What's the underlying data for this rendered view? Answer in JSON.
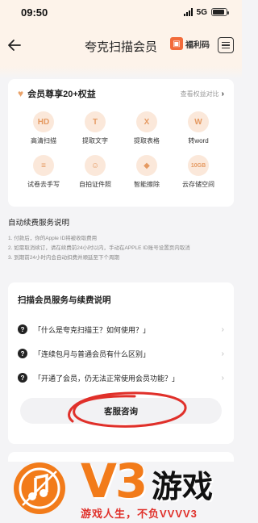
{
  "status_bar": {
    "time": "09:50",
    "network": "5G",
    "battery_level": 0.85
  },
  "nav": {
    "title": "夸克扫描会员",
    "gift_label": "福利码",
    "gift_icon": "gift-icon"
  },
  "benefits": {
    "title": "会员尊享20+权益",
    "compare_link": "查看权益对比",
    "items": [
      {
        "label": "高清扫描",
        "icon": "hd-scan-icon",
        "glyph": "HD"
      },
      {
        "label": "提取文字",
        "icon": "text-extract-icon",
        "glyph": "T"
      },
      {
        "label": "提取表格",
        "icon": "table-extract-icon",
        "glyph": "X"
      },
      {
        "label": "转word",
        "icon": "word-convert-icon",
        "glyph": "W"
      },
      {
        "label": "试卷去手写",
        "icon": "exam-icon",
        "glyph": "≡"
      },
      {
        "label": "自拍证件照",
        "icon": "id-photo-icon",
        "glyph": "☺"
      },
      {
        "label": "智能擦除",
        "icon": "eraser-icon",
        "glyph": "◆"
      },
      {
        "label": "云存储空间",
        "icon": "cloud-storage-icon",
        "glyph": "10GB"
      }
    ]
  },
  "renew": {
    "title": "自动续费服务说明",
    "items": [
      "1. 付款后，你的Apple ID将被收取费用",
      "2. 如需取消续订，请在续费前24小时以内，手动在APPLE ID账号设置页内取消",
      "3. 到期前24小时内会自动扣费并顺延至下个周期"
    ]
  },
  "faq": {
    "title": "扫描会员服务与续费说明",
    "items": [
      {
        "text": "「什么是夸克扫描王？如何使用？」"
      },
      {
        "text": "「连续包月与普通会员有什么区别」"
      },
      {
        "text": "「开通了会员，仍无法正常使用会员功能？」"
      }
    ],
    "service_button": "客服咨询"
  },
  "watermark": {
    "brand": "V3",
    "game": "游戏",
    "slogan": "游戏人生，不负VVVV3"
  },
  "colors": {
    "accent": "#f26b3a",
    "benefit_icon_bg": "#fbe8da",
    "benefit_icon_fg": "#e59a62",
    "annotation_red": "#e0302a"
  }
}
